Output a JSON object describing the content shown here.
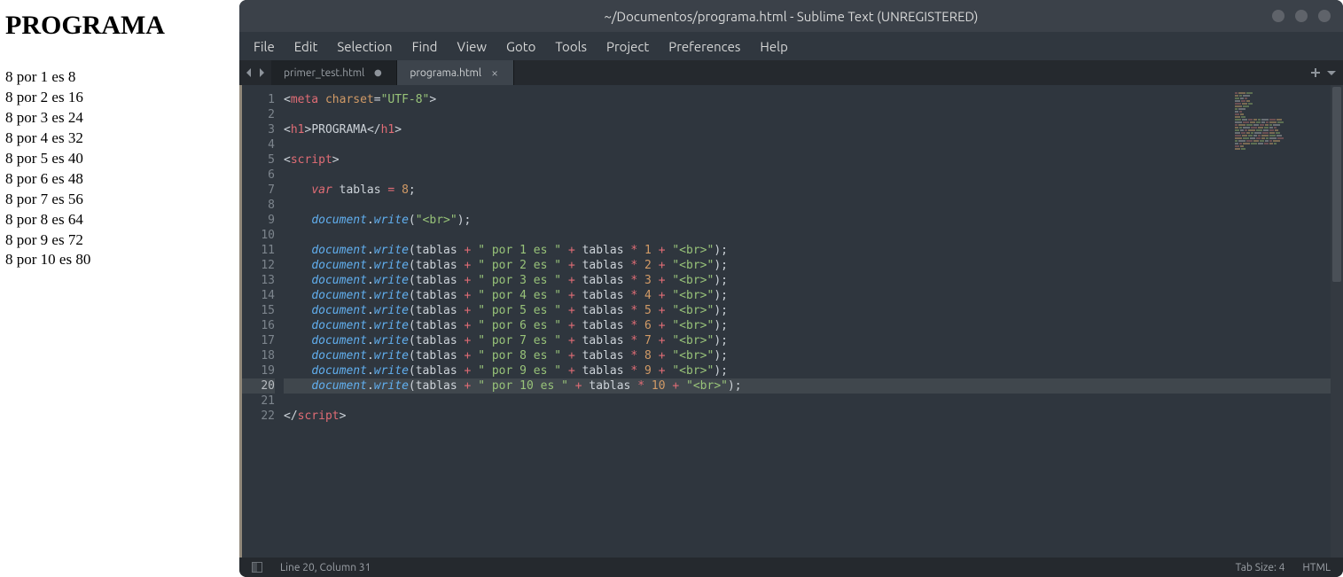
{
  "browser": {
    "heading": "PROGRAMA",
    "multiplier": 8,
    "lines": [
      "8 por 1 es 8",
      "8 por 2 es 16",
      "8 por 3 es 24",
      "8 por 4 es 32",
      "8 por 5 es 40",
      "8 por 6 es 48",
      "8 por 7 es 56",
      "8 por 8 es 64",
      "8 por 9 es 72",
      "8 por 10 es 80"
    ]
  },
  "window": {
    "title": "~/Documentos/programa.html - Sublime Text (UNREGISTERED)"
  },
  "menu": [
    "File",
    "Edit",
    "Selection",
    "Find",
    "View",
    "Goto",
    "Tools",
    "Project",
    "Preferences",
    "Help"
  ],
  "tabs": [
    {
      "label": "primer_test.html",
      "active": false,
      "dirty": true
    },
    {
      "label": "programa.html",
      "active": true,
      "dirty": false
    }
  ],
  "editor": {
    "highlight_line": 20,
    "line_numbers": [
      1,
      2,
      3,
      4,
      5,
      6,
      7,
      8,
      9,
      10,
      11,
      12,
      13,
      14,
      15,
      16,
      17,
      18,
      19,
      20,
      21,
      22
    ],
    "code": [
      [
        [
          "p",
          "<"
        ],
        [
          "t",
          "meta"
        ],
        [
          "p",
          " "
        ],
        [
          "a",
          "charset"
        ],
        [
          "p",
          "="
        ],
        [
          "s",
          "\"UTF-8\""
        ],
        [
          "p",
          ">"
        ]
      ],
      [],
      [
        [
          "p",
          "<"
        ],
        [
          "t",
          "h1"
        ],
        [
          "p",
          ">"
        ],
        [
          "txt",
          "PROGRAMA"
        ],
        [
          "p",
          "</"
        ],
        [
          "t",
          "h1"
        ],
        [
          "p",
          ">"
        ]
      ],
      [],
      [
        [
          "p",
          "<"
        ],
        [
          "t",
          "script"
        ],
        [
          "p",
          ">"
        ]
      ],
      [],
      [
        [
          "p",
          "    "
        ],
        [
          "k",
          "var"
        ],
        [
          "p",
          " "
        ],
        [
          "id",
          "tablas"
        ],
        [
          "p",
          " "
        ],
        [
          "o",
          "="
        ],
        [
          "p",
          " "
        ],
        [
          "n",
          "8"
        ],
        [
          "p",
          ";"
        ]
      ],
      [],
      [
        [
          "p",
          "    "
        ],
        [
          "obj",
          "document"
        ],
        [
          "p",
          "."
        ],
        [
          "fn",
          "write"
        ],
        [
          "p",
          "("
        ],
        [
          "s",
          "\"<br>\""
        ],
        [
          "p",
          ");"
        ]
      ],
      [],
      [
        [
          "p",
          "    "
        ],
        [
          "obj",
          "document"
        ],
        [
          "p",
          "."
        ],
        [
          "fn",
          "write"
        ],
        [
          "p",
          "("
        ],
        [
          "id",
          "tablas "
        ],
        [
          "o",
          "+"
        ],
        [
          "p",
          " "
        ],
        [
          "s",
          "\" por 1 es \""
        ],
        [
          "p",
          " "
        ],
        [
          "o",
          "+"
        ],
        [
          "p",
          " "
        ],
        [
          "id",
          "tablas "
        ],
        [
          "o",
          "*"
        ],
        [
          "p",
          " "
        ],
        [
          "n",
          "1"
        ],
        [
          "p",
          " "
        ],
        [
          "o",
          "+"
        ],
        [
          "p",
          " "
        ],
        [
          "s",
          "\"<br>\""
        ],
        [
          "p",
          ");"
        ]
      ],
      [
        [
          "p",
          "    "
        ],
        [
          "obj",
          "document"
        ],
        [
          "p",
          "."
        ],
        [
          "fn",
          "write"
        ],
        [
          "p",
          "("
        ],
        [
          "id",
          "tablas "
        ],
        [
          "o",
          "+"
        ],
        [
          "p",
          " "
        ],
        [
          "s",
          "\" por 2 es \""
        ],
        [
          "p",
          " "
        ],
        [
          "o",
          "+"
        ],
        [
          "p",
          " "
        ],
        [
          "id",
          "tablas "
        ],
        [
          "o",
          "*"
        ],
        [
          "p",
          " "
        ],
        [
          "n",
          "2"
        ],
        [
          "p",
          " "
        ],
        [
          "o",
          "+"
        ],
        [
          "p",
          " "
        ],
        [
          "s",
          "\"<br>\""
        ],
        [
          "p",
          ");"
        ]
      ],
      [
        [
          "p",
          "    "
        ],
        [
          "obj",
          "document"
        ],
        [
          "p",
          "."
        ],
        [
          "fn",
          "write"
        ],
        [
          "p",
          "("
        ],
        [
          "id",
          "tablas "
        ],
        [
          "o",
          "+"
        ],
        [
          "p",
          " "
        ],
        [
          "s",
          "\" por 3 es \""
        ],
        [
          "p",
          " "
        ],
        [
          "o",
          "+"
        ],
        [
          "p",
          " "
        ],
        [
          "id",
          "tablas "
        ],
        [
          "o",
          "*"
        ],
        [
          "p",
          " "
        ],
        [
          "n",
          "3"
        ],
        [
          "p",
          " "
        ],
        [
          "o",
          "+"
        ],
        [
          "p",
          " "
        ],
        [
          "s",
          "\"<br>\""
        ],
        [
          "p",
          ");"
        ]
      ],
      [
        [
          "p",
          "    "
        ],
        [
          "obj",
          "document"
        ],
        [
          "p",
          "."
        ],
        [
          "fn",
          "write"
        ],
        [
          "p",
          "("
        ],
        [
          "id",
          "tablas "
        ],
        [
          "o",
          "+"
        ],
        [
          "p",
          " "
        ],
        [
          "s",
          "\" por 4 es \""
        ],
        [
          "p",
          " "
        ],
        [
          "o",
          "+"
        ],
        [
          "p",
          " "
        ],
        [
          "id",
          "tablas "
        ],
        [
          "o",
          "*"
        ],
        [
          "p",
          " "
        ],
        [
          "n",
          "4"
        ],
        [
          "p",
          " "
        ],
        [
          "o",
          "+"
        ],
        [
          "p",
          " "
        ],
        [
          "s",
          "\"<br>\""
        ],
        [
          "p",
          ");"
        ]
      ],
      [
        [
          "p",
          "    "
        ],
        [
          "obj",
          "document"
        ],
        [
          "p",
          "."
        ],
        [
          "fn",
          "write"
        ],
        [
          "p",
          "("
        ],
        [
          "id",
          "tablas "
        ],
        [
          "o",
          "+"
        ],
        [
          "p",
          " "
        ],
        [
          "s",
          "\" por 5 es \""
        ],
        [
          "p",
          " "
        ],
        [
          "o",
          "+"
        ],
        [
          "p",
          " "
        ],
        [
          "id",
          "tablas "
        ],
        [
          "o",
          "*"
        ],
        [
          "p",
          " "
        ],
        [
          "n",
          "5"
        ],
        [
          "p",
          " "
        ],
        [
          "o",
          "+"
        ],
        [
          "p",
          " "
        ],
        [
          "s",
          "\"<br>\""
        ],
        [
          "p",
          ");"
        ]
      ],
      [
        [
          "p",
          "    "
        ],
        [
          "obj",
          "document"
        ],
        [
          "p",
          "."
        ],
        [
          "fn",
          "write"
        ],
        [
          "p",
          "("
        ],
        [
          "id",
          "tablas "
        ],
        [
          "o",
          "+"
        ],
        [
          "p",
          " "
        ],
        [
          "s",
          "\" por 6 es \""
        ],
        [
          "p",
          " "
        ],
        [
          "o",
          "+"
        ],
        [
          "p",
          " "
        ],
        [
          "id",
          "tablas "
        ],
        [
          "o",
          "*"
        ],
        [
          "p",
          " "
        ],
        [
          "n",
          "6"
        ],
        [
          "p",
          " "
        ],
        [
          "o",
          "+"
        ],
        [
          "p",
          " "
        ],
        [
          "s",
          "\"<br>\""
        ],
        [
          "p",
          ");"
        ]
      ],
      [
        [
          "p",
          "    "
        ],
        [
          "obj",
          "document"
        ],
        [
          "p",
          "."
        ],
        [
          "fn",
          "write"
        ],
        [
          "p",
          "("
        ],
        [
          "id",
          "tablas "
        ],
        [
          "o",
          "+"
        ],
        [
          "p",
          " "
        ],
        [
          "s",
          "\" por 7 es \""
        ],
        [
          "p",
          " "
        ],
        [
          "o",
          "+"
        ],
        [
          "p",
          " "
        ],
        [
          "id",
          "tablas "
        ],
        [
          "o",
          "*"
        ],
        [
          "p",
          " "
        ],
        [
          "n",
          "7"
        ],
        [
          "p",
          " "
        ],
        [
          "o",
          "+"
        ],
        [
          "p",
          " "
        ],
        [
          "s",
          "\"<br>\""
        ],
        [
          "p",
          ");"
        ]
      ],
      [
        [
          "p",
          "    "
        ],
        [
          "obj",
          "document"
        ],
        [
          "p",
          "."
        ],
        [
          "fn",
          "write"
        ],
        [
          "p",
          "("
        ],
        [
          "id",
          "tablas "
        ],
        [
          "o",
          "+"
        ],
        [
          "p",
          " "
        ],
        [
          "s",
          "\" por 8 es \""
        ],
        [
          "p",
          " "
        ],
        [
          "o",
          "+"
        ],
        [
          "p",
          " "
        ],
        [
          "id",
          "tablas "
        ],
        [
          "o",
          "*"
        ],
        [
          "p",
          " "
        ],
        [
          "n",
          "8"
        ],
        [
          "p",
          " "
        ],
        [
          "o",
          "+"
        ],
        [
          "p",
          " "
        ],
        [
          "s",
          "\"<br>\""
        ],
        [
          "p",
          ");"
        ]
      ],
      [
        [
          "p",
          "    "
        ],
        [
          "obj",
          "document"
        ],
        [
          "p",
          "."
        ],
        [
          "fn",
          "write"
        ],
        [
          "p",
          "("
        ],
        [
          "id",
          "tablas "
        ],
        [
          "o",
          "+"
        ],
        [
          "p",
          " "
        ],
        [
          "s",
          "\" por 9 es \""
        ],
        [
          "p",
          " "
        ],
        [
          "o",
          "+"
        ],
        [
          "p",
          " "
        ],
        [
          "id",
          "tablas "
        ],
        [
          "o",
          "*"
        ],
        [
          "p",
          " "
        ],
        [
          "n",
          "9"
        ],
        [
          "p",
          " "
        ],
        [
          "o",
          "+"
        ],
        [
          "p",
          " "
        ],
        [
          "s",
          "\"<br>\""
        ],
        [
          "p",
          ");"
        ]
      ],
      [
        [
          "p",
          "    "
        ],
        [
          "obj",
          "document"
        ],
        [
          "p",
          "."
        ],
        [
          "fn",
          "write"
        ],
        [
          "p",
          "("
        ],
        [
          "id",
          "tablas "
        ],
        [
          "o",
          "+"
        ],
        [
          "p",
          " "
        ],
        [
          "s",
          "\" por 10 es \""
        ],
        [
          "p",
          " "
        ],
        [
          "o",
          "+"
        ],
        [
          "p",
          " "
        ],
        [
          "id",
          "tablas "
        ],
        [
          "o",
          "*"
        ],
        [
          "p",
          " "
        ],
        [
          "n",
          "10"
        ],
        [
          "p",
          " "
        ],
        [
          "o",
          "+"
        ],
        [
          "p",
          " "
        ],
        [
          "s",
          "\"<br>\""
        ],
        [
          "p",
          ");"
        ]
      ],
      [],
      [
        [
          "p",
          "</"
        ],
        [
          "t",
          "script"
        ],
        [
          "p",
          ">"
        ]
      ]
    ]
  },
  "statusbar": {
    "position": "Line 20, Column 31",
    "indent": "Tab Size: 4",
    "syntax": "HTML"
  }
}
